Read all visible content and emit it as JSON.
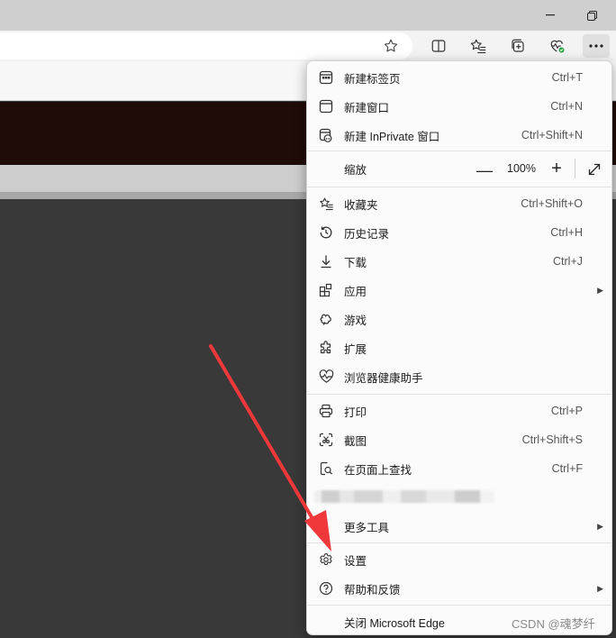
{
  "window": {
    "minimize_icon": "minimize-icon",
    "restore_icon": "restore-icon"
  },
  "toolbar": {
    "favorite_icon": "star-icon",
    "split_screen_icon": "split-screen-icon",
    "favorites_icon": "favorites-list-icon",
    "collections_icon": "collections-icon",
    "health_icon": "browser-essentials-icon",
    "more_icon": "more-dots-icon"
  },
  "menu": {
    "new_tab": {
      "label": "新建标签页",
      "shortcut": "Ctrl+T"
    },
    "new_window": {
      "label": "新建窗口",
      "shortcut": "Ctrl+N"
    },
    "new_inprivate": {
      "label": "新建 InPrivate 窗口",
      "shortcut": "Ctrl+Shift+N"
    },
    "zoom": {
      "label": "缩放",
      "minus": "—",
      "value": "100%",
      "plus": "+"
    },
    "favorites": {
      "label": "收藏夹",
      "shortcut": "Ctrl+Shift+O"
    },
    "history": {
      "label": "历史记录",
      "shortcut": "Ctrl+H"
    },
    "downloads": {
      "label": "下载",
      "shortcut": "Ctrl+J"
    },
    "apps": {
      "label": "应用"
    },
    "games": {
      "label": "游戏"
    },
    "extensions": {
      "label": "扩展"
    },
    "browser_essentials": {
      "label": "浏览器健康助手"
    },
    "print": {
      "label": "打印",
      "shortcut": "Ctrl+P"
    },
    "screenshot": {
      "label": "截图",
      "shortcut": "Ctrl+Shift+S"
    },
    "find": {
      "label": "在页面上查找",
      "shortcut": "Ctrl+F"
    },
    "more_tools": {
      "label": "更多工具"
    },
    "settings": {
      "label": "设置"
    },
    "help": {
      "label": "帮助和反馈"
    },
    "close_edge": {
      "label": "关闭 Microsoft Edge"
    }
  },
  "watermark": "CSDN @魂梦纤",
  "colors": {
    "annotation_arrow": "#f0383a",
    "menu_bg": "#fbfbfb",
    "banner": "#1f0b07"
  }
}
